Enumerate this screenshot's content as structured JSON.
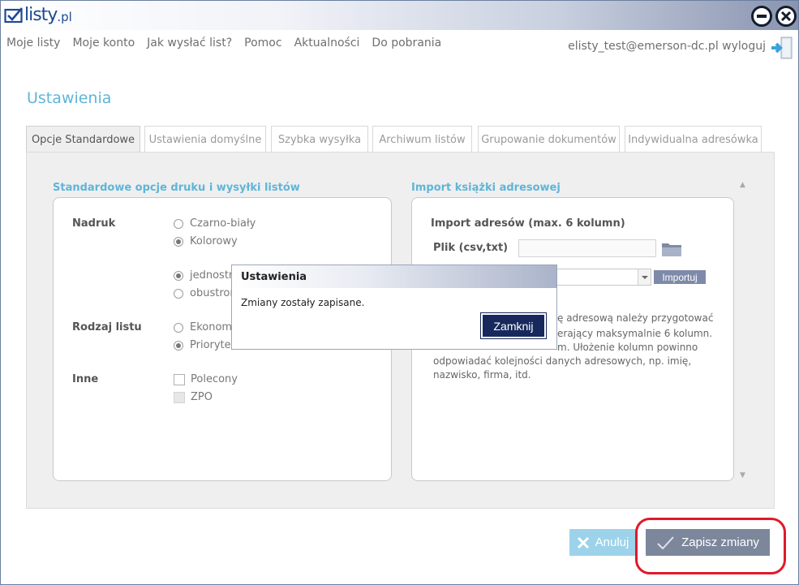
{
  "app": {
    "logo_text": "listy",
    "logo_suffix": ".pl"
  },
  "menu": {
    "items": [
      "Moje listy",
      "Moje konto",
      "Jak wysłać list?",
      "Pomoc",
      "Aktualności",
      "Do pobrania"
    ]
  },
  "user": {
    "email_logout": "elisty_test@emerson-dc.pl wyloguj"
  },
  "page": {
    "title": "Ustawienia"
  },
  "tabs": [
    "Opcje Standardowe",
    "Ustawienia domyślne",
    "Szybka wysyłka",
    "Archiwum listów",
    "Grupowanie dokumentów",
    "Indywidualna adresówka"
  ],
  "left": {
    "title": "Standardowe opcje druku i wysyłki listów",
    "nadruk": {
      "label": "Nadruk",
      "options": [
        "Czarno-biały",
        "Kolorowy"
      ],
      "selected": "Kolorowy"
    },
    "strony": {
      "options": [
        "jednostro",
        "obustron"
      ],
      "selected": "jednostro"
    },
    "rodzaj": {
      "label": "Rodzaj listu",
      "options": [
        "Ekonomic",
        "Prioryte"
      ],
      "selected": "Prioryte"
    },
    "inne": {
      "label": "Inne",
      "options": [
        "Polecony",
        "ZPO"
      ]
    }
  },
  "right": {
    "title": "Import książki adresowej",
    "heading": "Import adresów (max. 6 kolumn)",
    "file_label": "Plik (csv,txt)",
    "import_button": "Importuj",
    "description": [
      "ę adresową należy przygotować",
      "erający maksymalnie 6 kolumn.",
      "m. Ułożenie kolumn powinno",
      "odpowiadać kolejności danych adresowych, np. imię,",
      "nazwisko, firma, itd."
    ]
  },
  "footer": {
    "cancel_label": "Anuluj",
    "save_label": "Zapisz zmiany"
  },
  "modal": {
    "title": "Ustawienia",
    "message": "Zmiany zostały zapisane.",
    "close_label": "Zamknij"
  },
  "colors": {
    "accent": "#5fb5d8",
    "save_button": "#7d879c",
    "cancel_button": "#9dd3ea",
    "modal_button": "#17295c",
    "highlight": "#e0192b"
  }
}
